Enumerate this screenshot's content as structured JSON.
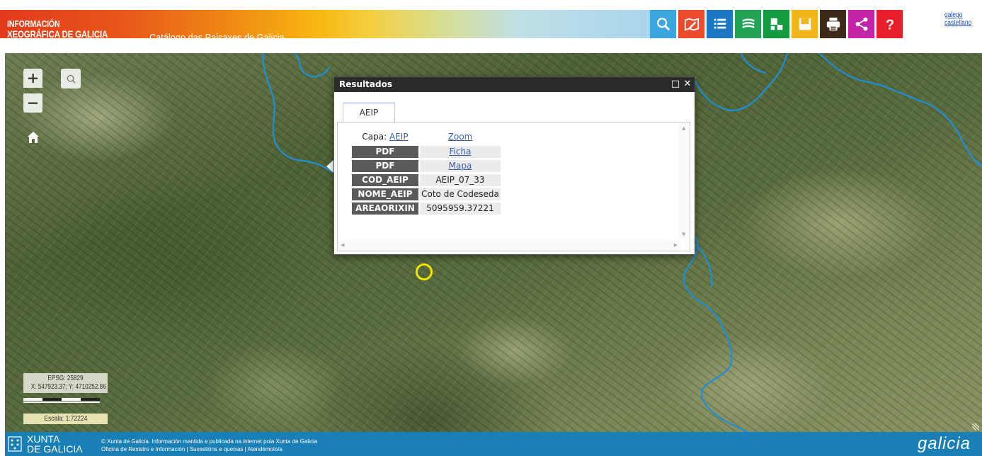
{
  "header": {
    "logo_line1": "INFORMACIÓN",
    "logo_line2": "XEOGRÁFICA DE GALICIA",
    "app_title": "Catálogo das Paisaxes de Galicia",
    "tools": [
      {
        "name": "search-tool",
        "icon": "search-icon",
        "color": "#3aa6dd"
      },
      {
        "name": "map-edit-tool",
        "icon": "map-pencil-icon",
        "color": "#ed4a2c"
      },
      {
        "name": "legend-tool",
        "icon": "list-icon",
        "color": "#1b76c4"
      },
      {
        "name": "layers-tool",
        "icon": "layers-icon",
        "color": "#22a356"
      },
      {
        "name": "mosaic-tool",
        "icon": "grid-icon",
        "color": "#149a3f"
      },
      {
        "name": "save-tool",
        "icon": "save-icon",
        "color": "#f2b51b"
      },
      {
        "name": "print-tool",
        "icon": "printer-icon",
        "color": "#3d2a1a"
      },
      {
        "name": "share-tool",
        "icon": "share-icon",
        "color": "#c424a7"
      },
      {
        "name": "help-tool",
        "icon": "question-icon",
        "color": "#e81f2a"
      }
    ],
    "languages": [
      "galego",
      "castellano"
    ]
  },
  "map": {
    "coords": {
      "epsg": "EPSG: 25829",
      "xy": "X: 547923.37; Y: 4710252.86"
    },
    "scale": "Escala: 1:72224",
    "marker_color": "#f2e600",
    "river_color": "#1d8fd8"
  },
  "popup": {
    "title": "Resultados",
    "tab": "AEIP",
    "capa_label": "Capa:",
    "capa_value": "AEIP",
    "zoom_label": "Zoom",
    "rows": [
      {
        "label": "PDF",
        "value": "Ficha",
        "link": true
      },
      {
        "label": "PDF",
        "value": "Mapa",
        "link": true
      },
      {
        "label": "COD_AEIP",
        "value": "AEIP_07_33",
        "link": false
      },
      {
        "label": "NOME_AEIP",
        "value": "Coto de Codeseda",
        "link": false
      },
      {
        "label": "AREAORIXIN",
        "value": "5095959.37221",
        "link": false
      }
    ]
  },
  "footer": {
    "xunta_line1": "XUNTA",
    "xunta_line2": "DE GALICIA",
    "legal_line1": "© Xunta de Galicia. Información mantida e publicada na internet pola Xunta de Galicia",
    "legal_links": [
      "Oficina de Rexistro e Información",
      "Suxestións e queixas",
      "Atendémolo/a"
    ],
    "brand": "galicia"
  }
}
